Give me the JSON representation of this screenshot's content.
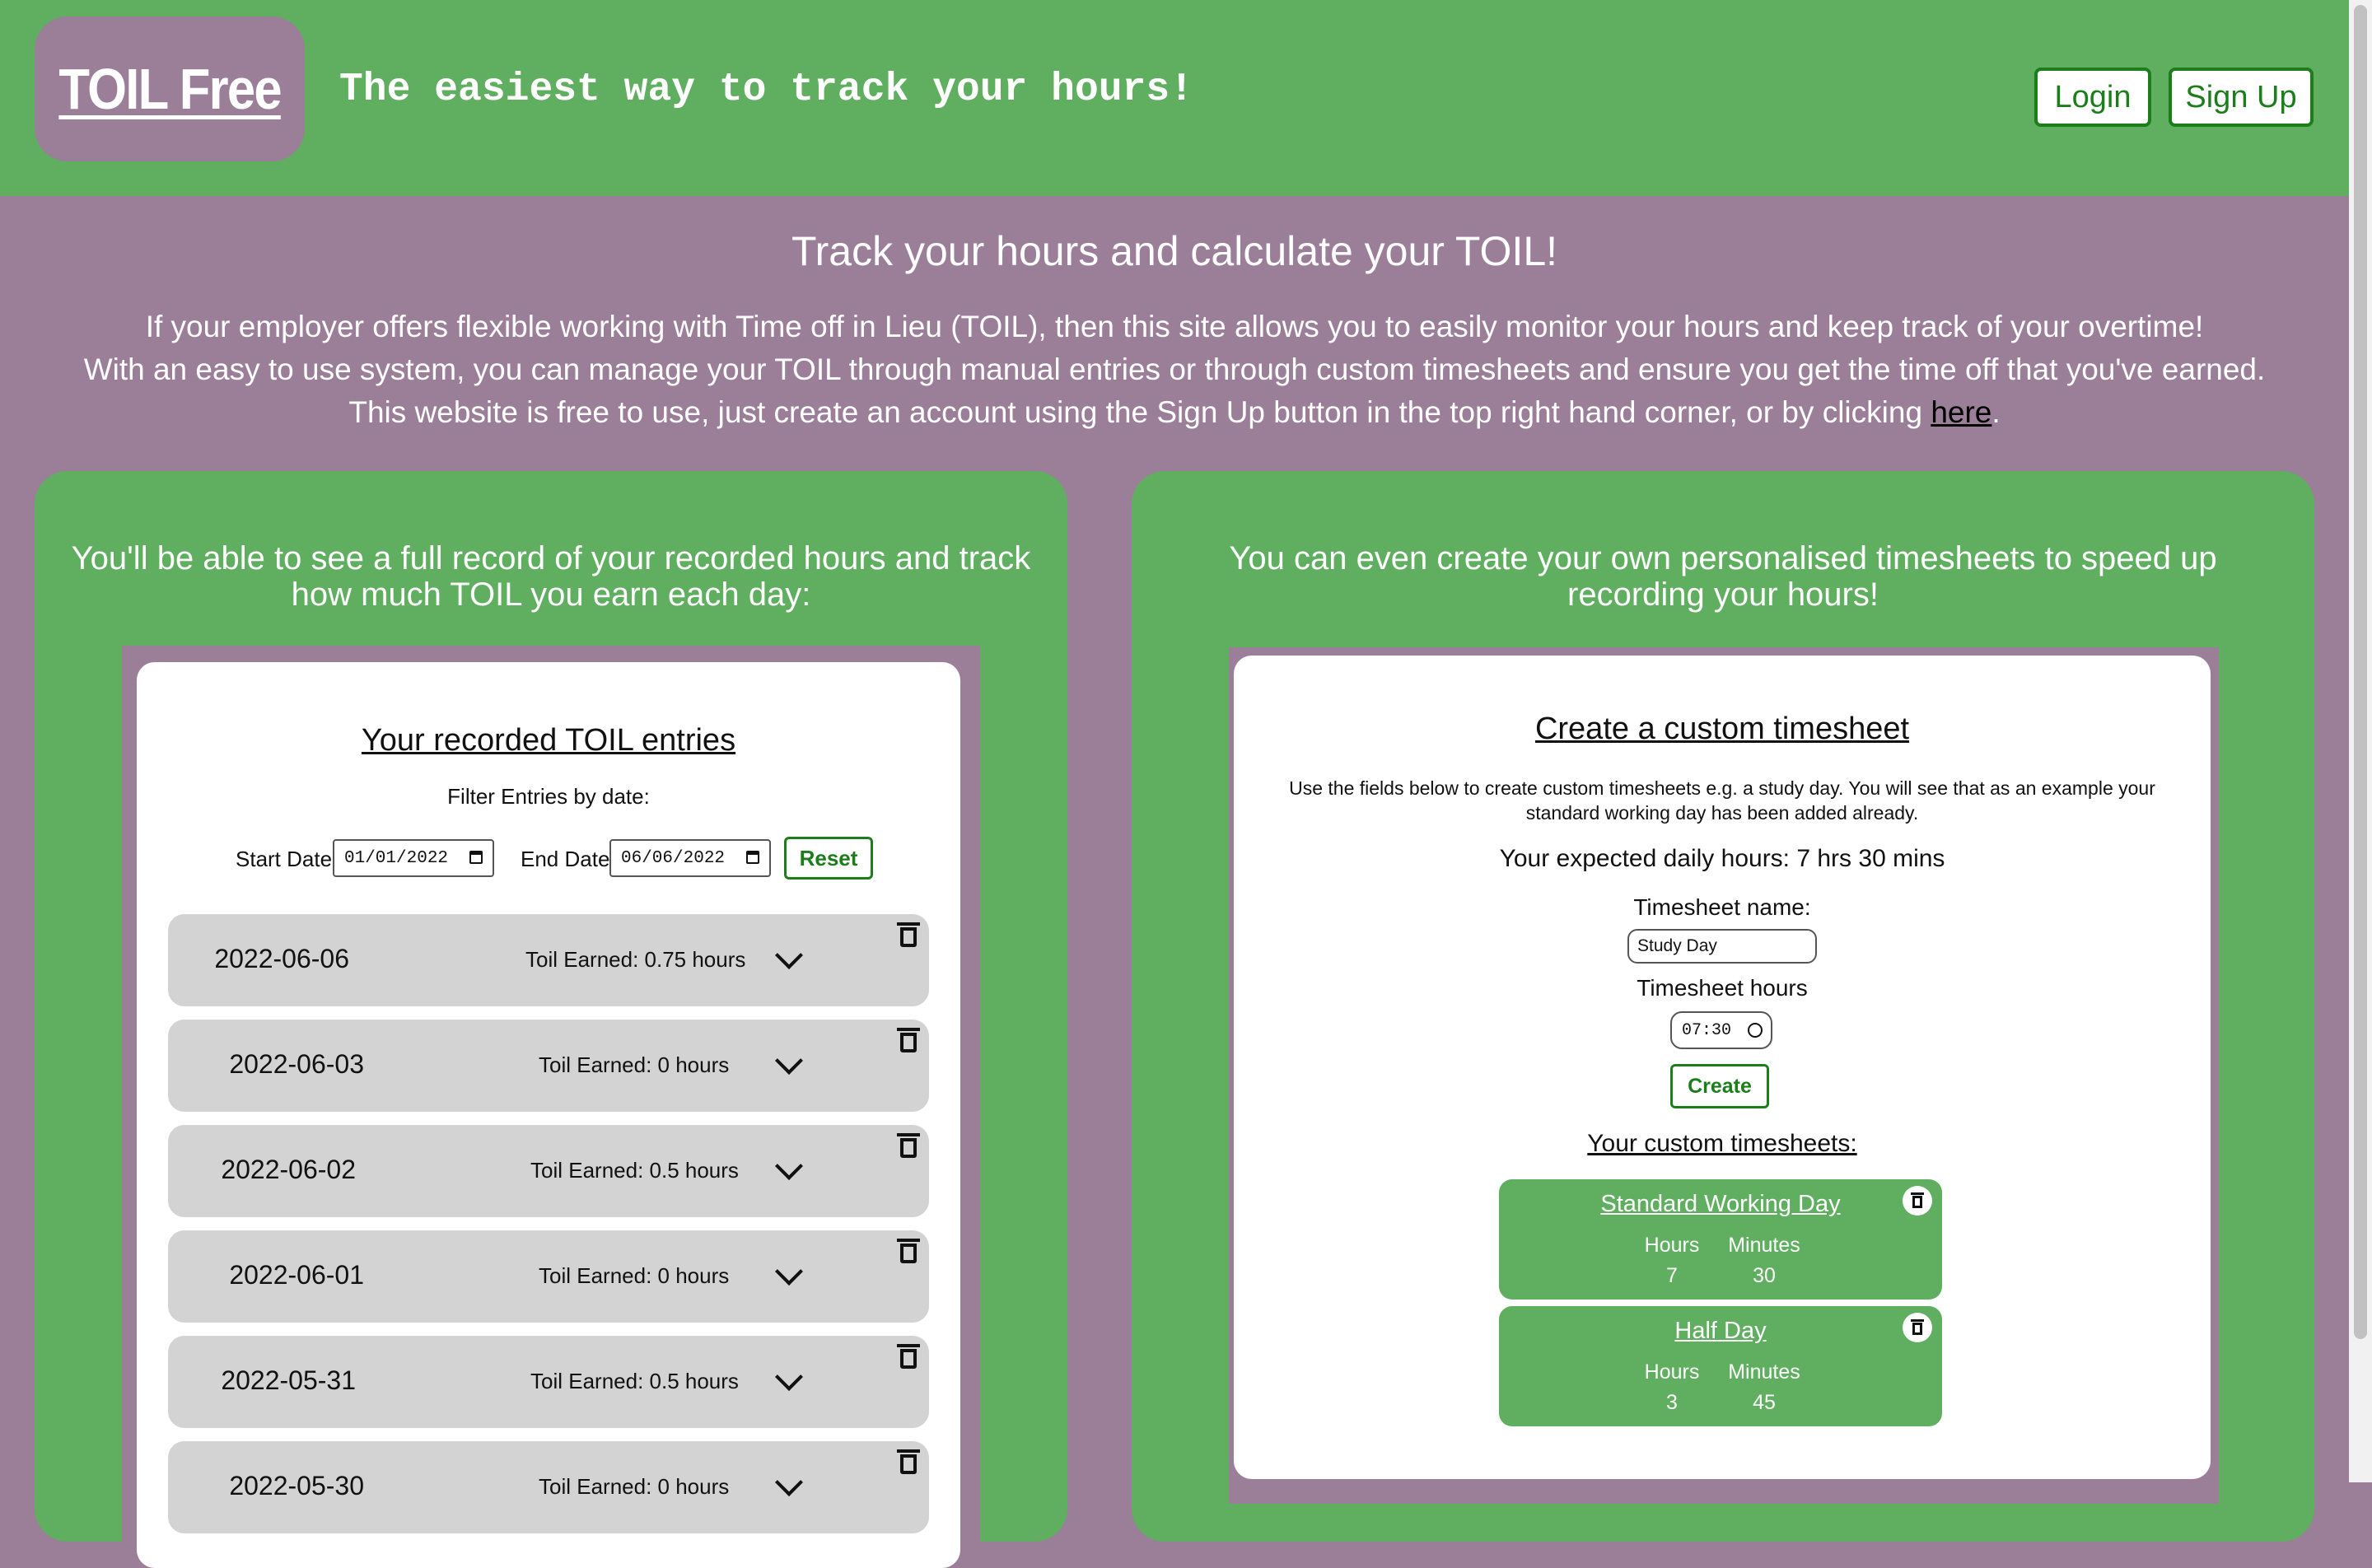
{
  "header": {
    "logo": "TOIL Free",
    "tagline": "The easiest way to track your hours!",
    "login_label": "Login",
    "signup_label": "Sign Up"
  },
  "intro": {
    "title": "Track your hours and calculate your TOIL!",
    "line1": "If your employer offers flexible working with Time off in Lieu (TOIL), then this site allows you to easily monitor your hours and keep track of your overtime!",
    "line2": "With an easy to use system, you can manage your TOIL through manual entries or through custom timesheets and ensure you get the time off that you've earned.",
    "line3_prefix": "This website is free to use, just create an account using the Sign Up button in the top right hand corner, or by clicking ",
    "line3_link": "here",
    "line3_suffix": "."
  },
  "left_panel": {
    "caption": "You'll be able to see a full record of your recorded hours and track how much TOIL you earn each day:",
    "card_title": "Your recorded TOIL entries",
    "filter_label": "Filter Entries by date:",
    "start_label": "Start Date:",
    "start_value": "01/01/2022",
    "end_label": "End Date:",
    "end_value": "06/06/2022",
    "reset_label": "Reset",
    "entries": [
      {
        "date": "2022-06-06",
        "toil": "Toil Earned: 0.75 hours"
      },
      {
        "date": "2022-06-03",
        "toil": "Toil Earned: 0 hours"
      },
      {
        "date": "2022-06-02",
        "toil": "Toil Earned: 0.5 hours"
      },
      {
        "date": "2022-06-01",
        "toil": "Toil Earned: 0 hours"
      },
      {
        "date": "2022-05-31",
        "toil": "Toil Earned: 0.5 hours"
      },
      {
        "date": "2022-05-30",
        "toil": "Toil Earned: 0 hours"
      }
    ]
  },
  "right_panel": {
    "caption": "You can even create your own personalised timesheets to speed up recording your hours!",
    "card_title": "Create a custom timesheet",
    "description": "Use the fields below to create custom timesheets e.g. a study day. You will see that as an example your standard working day has been added already.",
    "expected": "Your expected daily hours: 7 hrs 30 mins",
    "name_label": "Timesheet name:",
    "name_value": "Study Day",
    "hours_label": "Timesheet hours",
    "hours_value": "07:30",
    "create_label": "Create",
    "list_title": "Your custom timesheets:",
    "timesheets": [
      {
        "name": "Standard Working Day",
        "hours_label": "Hours",
        "minutes_label": "Minutes",
        "hours": "7",
        "minutes": "30"
      },
      {
        "name": "Half Day",
        "hours_label": "Hours",
        "minutes_label": "Minutes",
        "hours": "3",
        "minutes": "45"
      }
    ]
  },
  "colors": {
    "green": "#60ae60",
    "purple": "#9b7e98",
    "button_green": "#1b7e1b",
    "entry_grey": "#d3d3d3"
  }
}
